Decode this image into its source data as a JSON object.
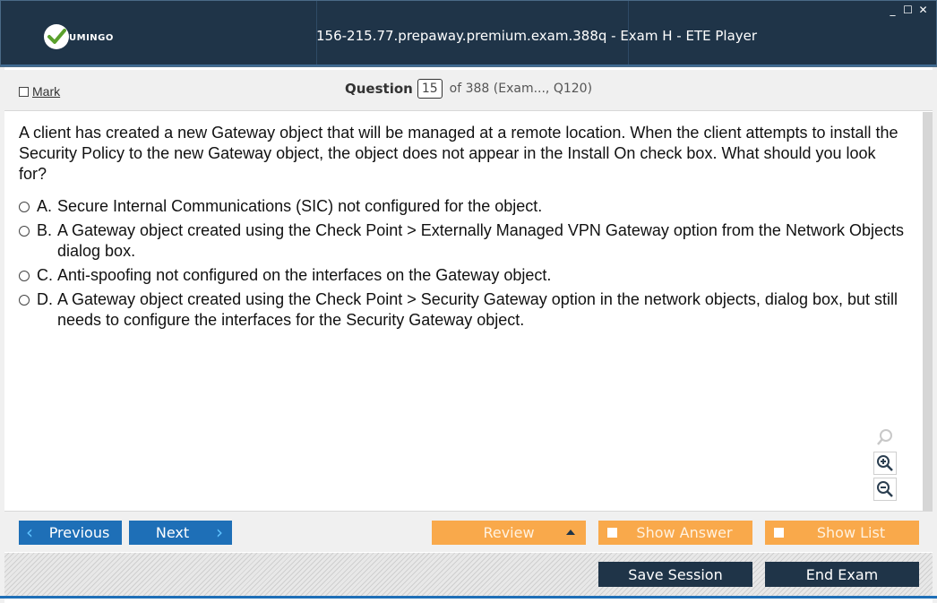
{
  "window": {
    "title": "156-215.77.prepaway.premium.exam.388q - Exam H - ETE Player",
    "logo_text": "UMINGO",
    "controls": [
      "minimize-icon",
      "maximize-icon",
      "close-icon"
    ]
  },
  "header": {
    "mark_label": "Mark",
    "question_label": "Question",
    "question_number": "15",
    "question_of": "of 388 (Exam..., Q120)"
  },
  "question": {
    "text": "A client has created a new Gateway object that will be managed at a remote location. When the client attempts to install the Security Policy to the new Gateway object, the object does not appear in the Install On check box. What should you look for?",
    "options": [
      {
        "letter": "A.",
        "text": "Secure Internal Communications (SIC) not configured for the object."
      },
      {
        "letter": "B.",
        "text": "A Gateway object created using the Check Point > Externally Managed VPN Gateway option from the Network Objects dialog box."
      },
      {
        "letter": "C.",
        "text": "Anti-spoofing not configured on the interfaces on the Gateway object."
      },
      {
        "letter": "D.",
        "text": "A Gateway object created using the Check Point > Security Gateway option in the network objects, dialog box, but still needs to configure the interfaces for the Security Gateway object."
      }
    ]
  },
  "zoom": [
    "search-icon",
    "zoom-in-icon",
    "zoom-out-icon"
  ],
  "nav": {
    "previous_label": "Previous",
    "next_label": "Next",
    "review_label": "Review",
    "show_answer_label": "Show Answer",
    "show_list_label": "Show List"
  },
  "footer": {
    "save_label": "Save Session",
    "end_label": "End Exam"
  },
  "colors": {
    "titlebar": "#1f3448",
    "blue_button": "#1e6fb7",
    "orange_button": "#f9a94b",
    "dark_button": "#1f3448"
  }
}
